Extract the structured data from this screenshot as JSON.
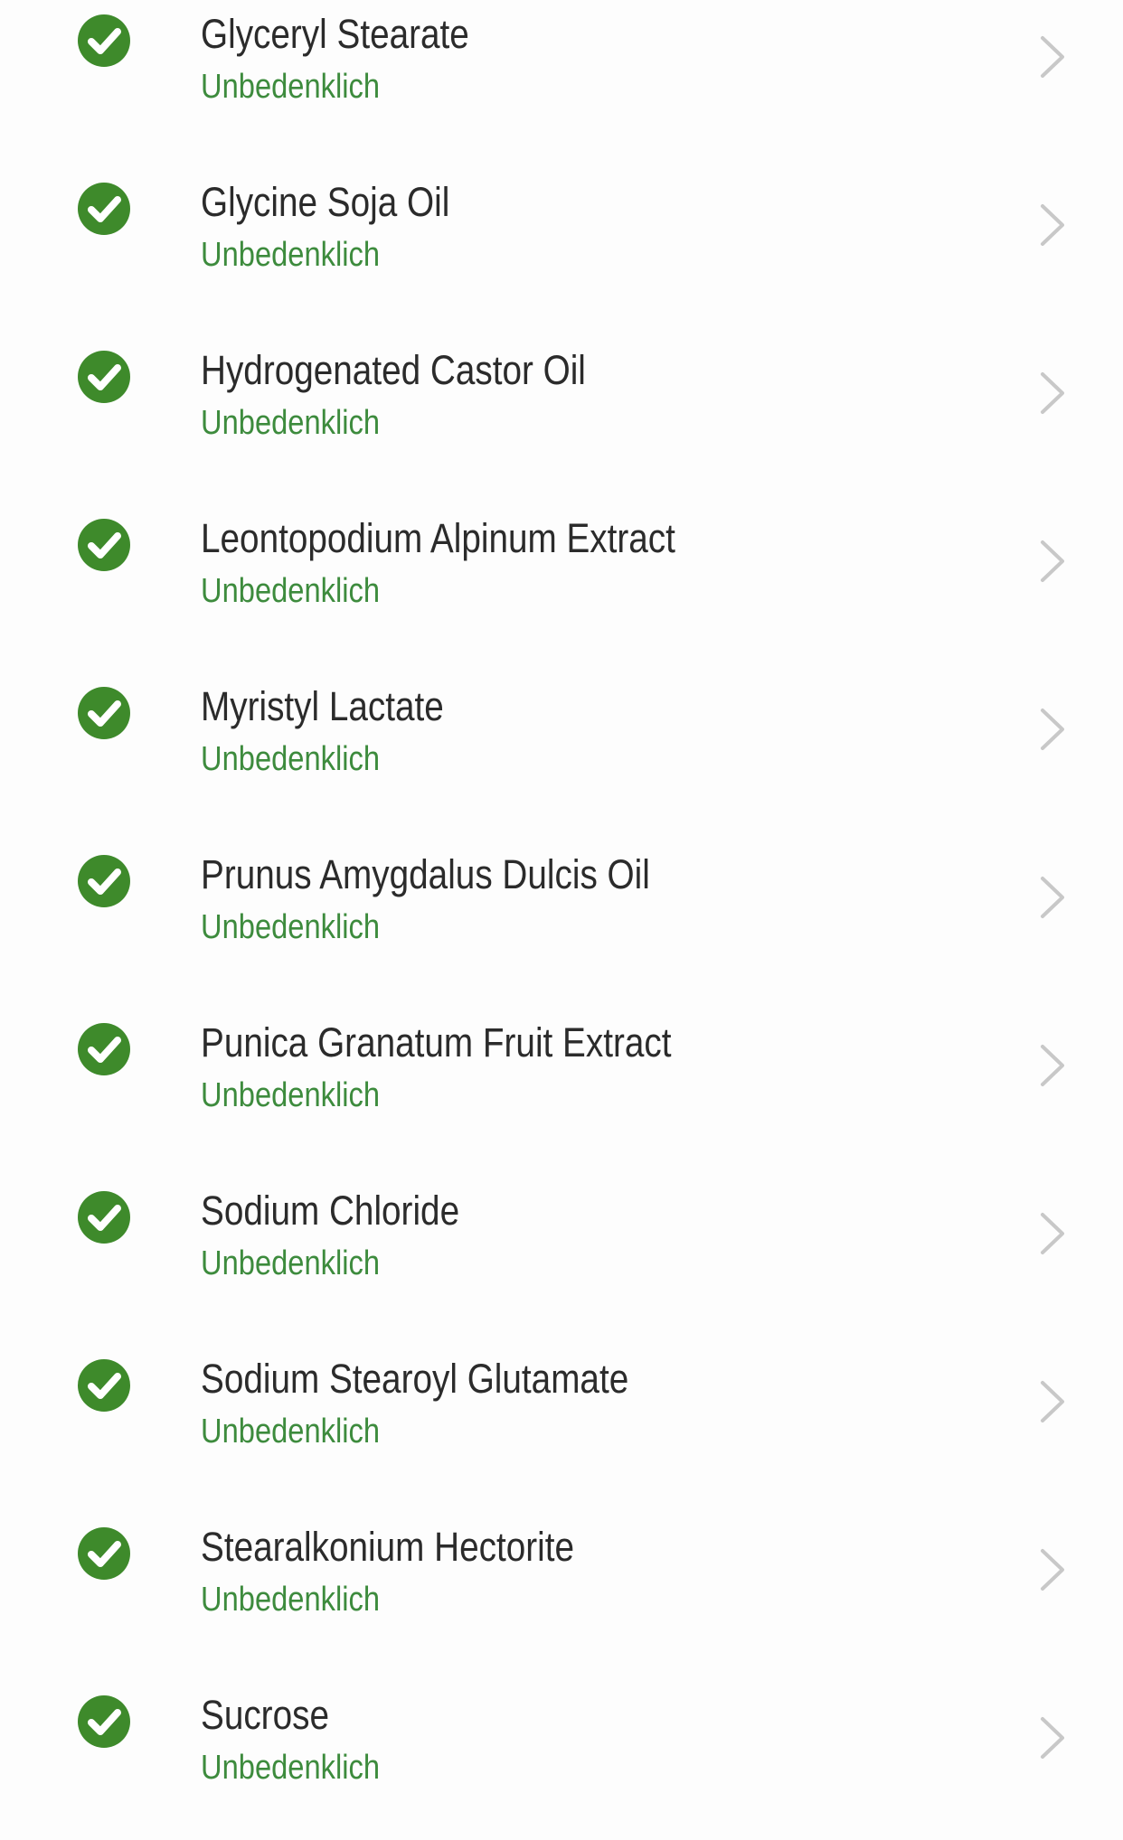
{
  "colors": {
    "check": "#3e8a2b",
    "status": "#3d8b3d",
    "chevron": "#c8c8c8"
  },
  "ingredients": [
    {
      "name": "Glyceryl Stearate",
      "status": "Unbedenklich",
      "icon": "check-circle-icon"
    },
    {
      "name": "Glycine Soja Oil",
      "status": "Unbedenklich",
      "icon": "check-circle-icon"
    },
    {
      "name": "Hydrogenated Castor Oil",
      "status": "Unbedenklich",
      "icon": "check-circle-icon"
    },
    {
      "name": "Leontopodium Alpinum Extract",
      "status": "Unbedenklich",
      "icon": "check-circle-icon"
    },
    {
      "name": "Myristyl Lactate",
      "status": "Unbedenklich",
      "icon": "check-circle-icon"
    },
    {
      "name": "Prunus Amygdalus Dulcis Oil",
      "status": "Unbedenklich",
      "icon": "check-circle-icon"
    },
    {
      "name": "Punica Granatum Fruit Extract",
      "status": "Unbedenklich",
      "icon": "check-circle-icon"
    },
    {
      "name": "Sodium Chloride",
      "status": "Unbedenklich",
      "icon": "check-circle-icon"
    },
    {
      "name": "Sodium Stearoyl Glutamate",
      "status": "Unbedenklich",
      "icon": "check-circle-icon"
    },
    {
      "name": "Stearalkonium Hectorite",
      "status": "Unbedenklich",
      "icon": "check-circle-icon"
    },
    {
      "name": "Sucrose",
      "status": "Unbedenklich",
      "icon": "check-circle-icon"
    }
  ]
}
